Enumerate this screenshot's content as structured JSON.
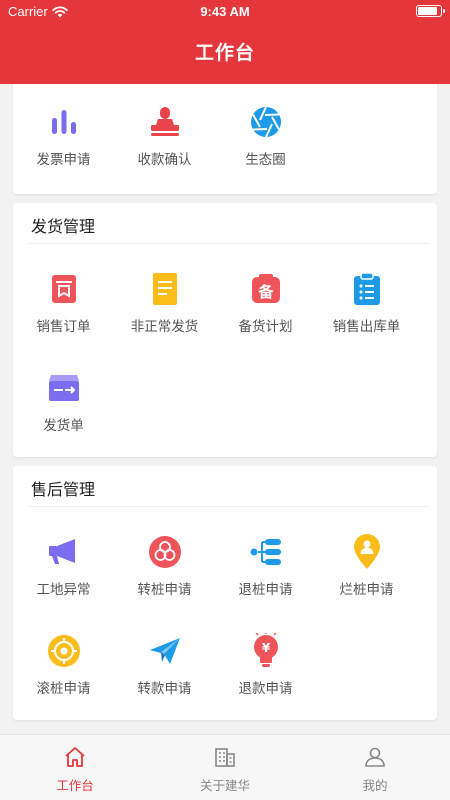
{
  "status_bar": {
    "carrier": "Carrier",
    "time": "9:43 AM",
    "battery_level": 0.9
  },
  "header": {
    "title": "工作台"
  },
  "colors": {
    "brand": "#e5363b",
    "tab_inactive": "#888888"
  },
  "top_section": {
    "items": [
      {
        "label": "发票申请",
        "icon": "bar-chart-icon"
      },
      {
        "label": "收款确认",
        "icon": "stamp-icon"
      },
      {
        "label": "生态圈",
        "icon": "aperture-icon"
      }
    ]
  },
  "shipping_section": {
    "title": "发货管理",
    "items": [
      {
        "label": "销售订单",
        "icon": "order-icon"
      },
      {
        "label": "非正常发货",
        "icon": "abnormal-shipment-icon"
      },
      {
        "label": "备货计划",
        "icon": "stock-plan-icon"
      },
      {
        "label": "销售出库单",
        "icon": "clipboard-icon"
      },
      {
        "label": "发货单",
        "icon": "shipping-box-icon"
      }
    ],
    "stock_badge": "备"
  },
  "after_sales_section": {
    "title": "售后管理",
    "items": [
      {
        "label": "工地异常",
        "icon": "megaphone-icon"
      },
      {
        "label": "转桩申请",
        "icon": "transfer-circles-icon"
      },
      {
        "label": "退桩申请",
        "icon": "tree-list-icon"
      },
      {
        "label": "烂桩申请",
        "icon": "location-pin-icon"
      },
      {
        "label": "滚桩申请",
        "icon": "target-icon"
      },
      {
        "label": "转款申请",
        "icon": "paper-plane-icon"
      },
      {
        "label": "退款申请",
        "icon": "refund-bulb-icon"
      }
    ],
    "refund_symbol": "¥"
  },
  "tabbar": {
    "tabs": [
      {
        "label": "工作台",
        "icon": "home-icon",
        "active": true
      },
      {
        "label": "关于建华",
        "icon": "building-icon",
        "active": false
      },
      {
        "label": "我的",
        "icon": "user-icon",
        "active": false
      }
    ]
  }
}
